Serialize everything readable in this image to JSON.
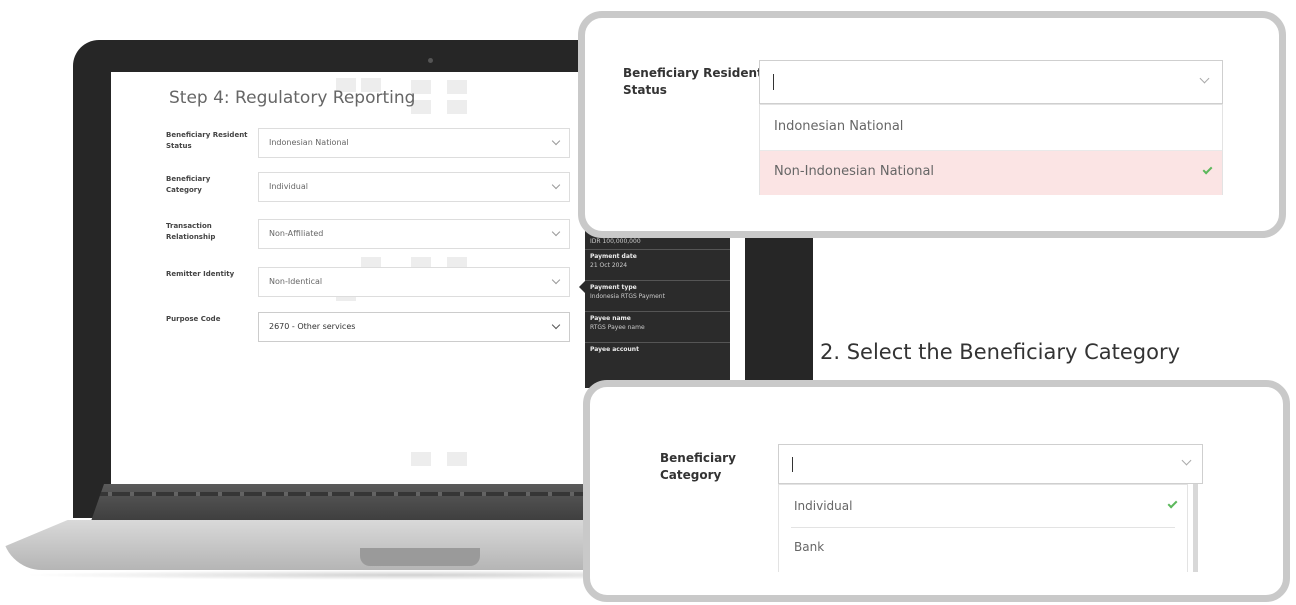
{
  "form": {
    "step_title": "Step 4: Regulatory Reporting",
    "fields": [
      {
        "label": "Beneficiary Resident Status",
        "value": "Indonesian National"
      },
      {
        "label": "Beneficiary Category",
        "value": "Individual"
      },
      {
        "label": "Transaction Relationship",
        "value": "Non-Affiliated"
      },
      {
        "label": "Remitter Identity",
        "value": "Non-Identical"
      },
      {
        "label": "Purpose Code",
        "value": "2670 - Other services"
      }
    ]
  },
  "summary": {
    "items": [
      {
        "label": "",
        "value": "IDR 100,000,000"
      },
      {
        "label": "Payment date",
        "value": "21 Oct 2024"
      },
      {
        "label": "Payment type",
        "value": "Indonesia RTGS Payment"
      },
      {
        "label": "Payee name",
        "value": "RTGS Payee name"
      },
      {
        "label": "Payee account",
        "value": ""
      }
    ]
  },
  "callout_resident": {
    "label": "Beneficiary Resident Status",
    "input_value": "",
    "options": [
      "Indonesian National",
      "Non-Indonesian National"
    ],
    "selected": "Non-Indonesian National"
  },
  "step_caption": "2. Select the Beneficiary Category",
  "callout_category": {
    "label": "Beneficiary Category",
    "input_value": "",
    "options": [
      "Individual",
      "Bank"
    ],
    "selected": "Individual"
  },
  "colors": {
    "selected_option_bg": "#fbe4e4",
    "check": "#5cb85c",
    "callout_border": "#c9c9c9"
  }
}
